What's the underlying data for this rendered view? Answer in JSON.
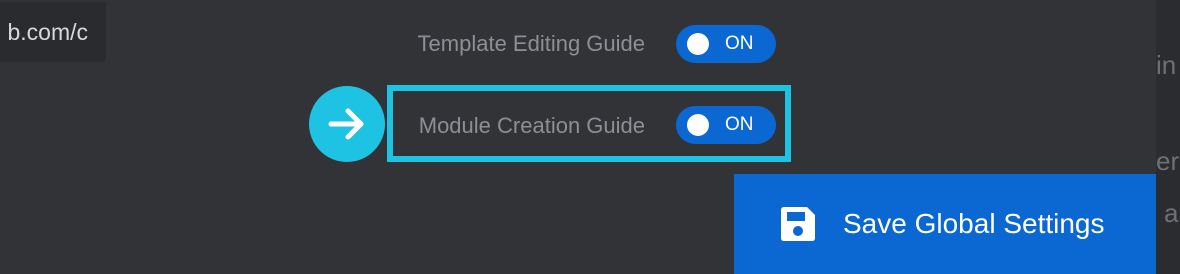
{
  "url_tooltip": {
    "text": "b.com/c"
  },
  "settings": {
    "rows": [
      {
        "label": "Template Editing Guide",
        "state": "ON",
        "enabled": true
      },
      {
        "label": "Module Creation Guide",
        "state": "ON",
        "enabled": true
      }
    ]
  },
  "save_button": {
    "label": "Save Global Settings",
    "icon": "floppy-disk-icon"
  },
  "background_fragments": [
    "in",
    "er",
    "a"
  ],
  "colors": {
    "background": "#323337",
    "toggle_on": "#0b67d1",
    "highlight": "#1ec3e3",
    "button": "#0b67d1"
  },
  "icons": {
    "highlight_badge": "arrow-right-icon",
    "save": "floppy-disk-icon"
  }
}
